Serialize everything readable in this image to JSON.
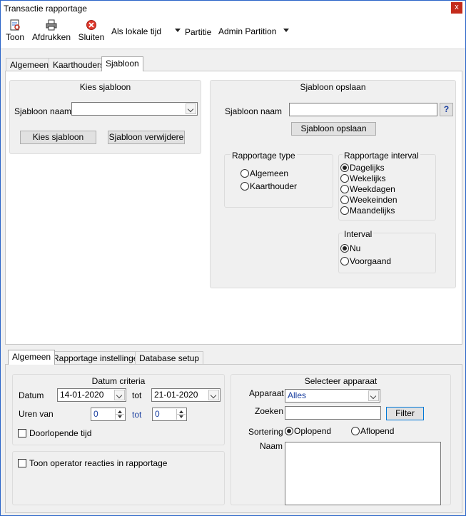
{
  "window": {
    "title": "Transactie rapportage",
    "close": "x"
  },
  "toolbar": {
    "toon": "Toon",
    "afdrukken": "Afdrukken",
    "sluiten": "Sluiten",
    "time_select": "Als lokale tijd",
    "partition_label": "Partitie",
    "partition_select": "Admin Partition"
  },
  "top_tabs": [
    "Algemeen",
    "Kaarthouders",
    "Sjabloon"
  ],
  "kies": {
    "title": "Kies sjabloon",
    "name_label": "Sjabloon naam",
    "name_value": "",
    "kies_button": "Kies sjabloon",
    "delete_button": "Sjabloon verwijdere"
  },
  "opslaan": {
    "title": "Sjabloon opslaan",
    "name_label": "Sjabloon naam",
    "name_value": "",
    "help": "?",
    "save_button": "Sjabloon opslaan",
    "type_title": "Rapportage type",
    "type_options": [
      "Algemeen",
      "Kaarthouder"
    ],
    "type_selected": null,
    "interval_title": "Rapportage interval",
    "interval_options": [
      "Dagelijks",
      "Wekelijks",
      "Weekdagen",
      "Weekeinden",
      "Maandelijks"
    ],
    "interval_selected": "Dagelijks",
    "interval2_title": "Interval",
    "interval2_options": [
      "Nu",
      "Voorgaand"
    ],
    "interval2_selected": "Nu"
  },
  "bottom_tabs": [
    "Algemeen",
    "Rapportage instellingen",
    "Database setup"
  ],
  "datum": {
    "title": "Datum criteria",
    "datum_label": "Datum",
    "from": "14-01-2020",
    "tot_label": "tot",
    "to": "21-01-2020",
    "uren_label": "Uren van",
    "uren_from": "0",
    "uren_tot_label": "tot",
    "uren_to": "0",
    "doorlopende": "Doorlopende tijd",
    "doorlopende_checked": false
  },
  "operator": {
    "label": "Toon operator reacties in rapportage",
    "checked": false
  },
  "apparaat": {
    "title": "Selecteer apparaat",
    "apparaat_label": "Apparaat",
    "apparaat_value": "Alles",
    "zoeken_label": "Zoeken",
    "zoeken_value": "",
    "filter_button": "Filter",
    "sortering_label": "Sortering",
    "sort_options": [
      "Oplopend",
      "Aflopend"
    ],
    "sort_selected": "Oplopend",
    "naam_label": "Naam"
  },
  "colors": {
    "window_border": "#2a64c8",
    "close_bg": "#c42b1c",
    "link_blue": "#1a3fa0",
    "accent": "#0078d7"
  }
}
